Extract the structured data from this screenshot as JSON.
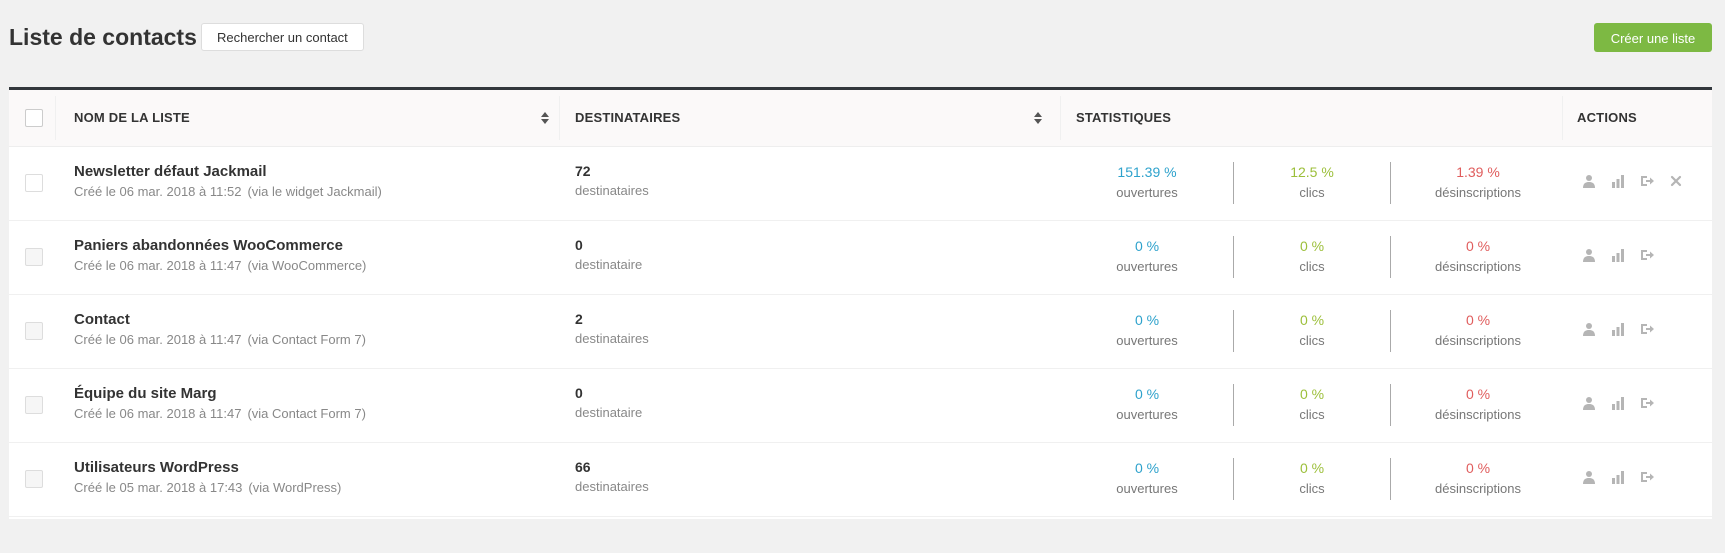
{
  "header": {
    "title": "Liste de contacts",
    "search_label": "Rechercher un contact",
    "create_label": "Créer une liste"
  },
  "columns": {
    "name": "NOM DE LA LISTE",
    "recipients": "DESTINATAIRES",
    "stats": "STATISTIQUES",
    "actions": "ACTIONS"
  },
  "colors": {
    "accent_green": "#7db943",
    "open_blue": "#2ea2cc",
    "click_green": "#9cbf3a",
    "unsub_red": "#e05d5d",
    "header_border": "#32373c"
  },
  "rows": [
    {
      "name": "Newsletter défaut Jackmail",
      "created": "Créé le 06 mar. 2018 à 11:52",
      "source": "(via le widget Jackmail)",
      "count": "72",
      "count_label": "destinataires",
      "opens": "151.39 %",
      "opens_label": "ouvertures",
      "clicks": "12.5 %",
      "clicks_label": "clics",
      "unsubs": "1.39 %",
      "unsubs_label": "désinscriptions",
      "actions": [
        "person-icon",
        "bar-chart-icon",
        "export-icon",
        "close-icon"
      ]
    },
    {
      "name": "Paniers abandonnées WooCommerce",
      "created": "Créé le 06 mar. 2018 à 11:47",
      "source": "(via WooCommerce)",
      "count": "0",
      "count_label": "destinataire",
      "opens": "0 %",
      "opens_label": "ouvertures",
      "clicks": "0 %",
      "clicks_label": "clics",
      "unsubs": "0 %",
      "unsubs_label": "désinscriptions",
      "actions": [
        "person-icon",
        "bar-chart-icon",
        "export-icon"
      ]
    },
    {
      "name": "Contact",
      "created": "Créé le 06 mar. 2018 à 11:47",
      "source": "(via Contact Form 7)",
      "count": "2",
      "count_label": "destinataires",
      "opens": "0 %",
      "opens_label": "ouvertures",
      "clicks": "0 %",
      "clicks_label": "clics",
      "unsubs": "0 %",
      "unsubs_label": "désinscriptions",
      "actions": [
        "person-icon",
        "bar-chart-icon",
        "export-icon"
      ]
    },
    {
      "name": "Équipe du site Marg",
      "created": "Créé le 06 mar. 2018 à 11:47",
      "source": "(via Contact Form 7)",
      "count": "0",
      "count_label": "destinataire",
      "opens": "0 %",
      "opens_label": "ouvertures",
      "clicks": "0 %",
      "clicks_label": "clics",
      "unsubs": "0 %",
      "unsubs_label": "désinscriptions",
      "actions": [
        "person-icon",
        "bar-chart-icon",
        "export-icon"
      ]
    },
    {
      "name": "Utilisateurs WordPress",
      "created": "Créé le 05 mar. 2018 à 17:43",
      "source": "(via WordPress)",
      "count": "66",
      "count_label": "destinataires",
      "opens": "0 %",
      "opens_label": "ouvertures",
      "clicks": "0 %",
      "clicks_label": "clics",
      "unsubs": "0 %",
      "unsubs_label": "désinscriptions",
      "actions": [
        "person-icon",
        "bar-chart-icon",
        "export-icon"
      ]
    }
  ]
}
